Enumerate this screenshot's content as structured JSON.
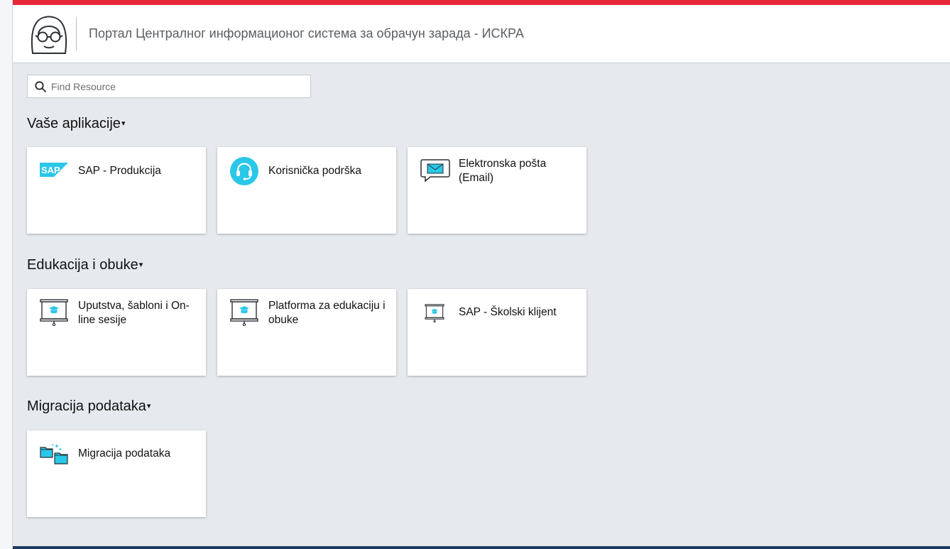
{
  "header": {
    "title": "Портал Централног информационог система за обрачун зарада - ИСКРА"
  },
  "search": {
    "placeholder": "Find Resource"
  },
  "sections": [
    {
      "title": "Vaše aplikacije",
      "tiles": [
        {
          "label": "SAP - Produkcija",
          "icon": "sap-logo-icon"
        },
        {
          "label": "Korisnička podrška",
          "icon": "headset-support-icon"
        },
        {
          "label": "Elektronska pošta (Email)",
          "icon": "email-message-icon"
        }
      ]
    },
    {
      "title": "Edukacija i obuke",
      "tiles": [
        {
          "label": "Uputstva, šabloni i On-line sesije",
          "icon": "presentation-board-icon"
        },
        {
          "label": "Platforma za edukaciju i obuke",
          "icon": "presentation-board-icon"
        },
        {
          "label": "SAP - Školski klijent",
          "icon": "presentation-board-small-icon"
        }
      ]
    },
    {
      "title": "Migracija podataka",
      "tiles": [
        {
          "label": "Migracija podataka",
          "icon": "folder-migration-icon"
        }
      ]
    }
  ],
  "colors": {
    "accent_red": "#e8263a",
    "icon_cyan": "#29c7e8",
    "page_bg": "#e6eaee",
    "bottom_bar": "#1f3b63"
  }
}
